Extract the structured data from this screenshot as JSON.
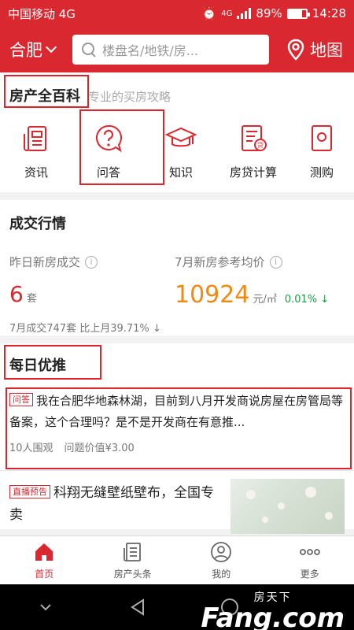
{
  "status_bar": {
    "carrier": "中国移动 4G",
    "network": "4G",
    "battery": "89%",
    "time": "14:28"
  },
  "header": {
    "city": "合肥",
    "search_placeholder": "楼盘名/地铁/房...",
    "map_label": "地图"
  },
  "encyclopedia": {
    "title": "房产全百科",
    "subtitle": "专业的买房攻略",
    "items": [
      {
        "label": "资讯",
        "icon": "news-icon"
      },
      {
        "label": "问答",
        "icon": "question-icon"
      },
      {
        "label": "知识",
        "icon": "graduation-cap-icon"
      },
      {
        "label": "房贷计算",
        "icon": "loan-calculator-icon"
      },
      {
        "label": "测购",
        "icon": "assess-icon"
      }
    ]
  },
  "market": {
    "title": "成交行情",
    "new_sales_label": "昨日新房成交",
    "new_sales_value": "6",
    "new_sales_unit": "套",
    "avg_price_label": "7月新房参考均价",
    "avg_price_value": "10924",
    "avg_price_unit": "元/㎡",
    "avg_price_change": "0.01%",
    "month_summary": "7月成交747套 比上月39.71%"
  },
  "daily": {
    "title": "每日优推",
    "qa_tag": "问答",
    "qa_question": "我在合肥华地森林湖，目前到八月开发商说房屋在房管局等备案，这个合理吗？是不是开发商在有意推...",
    "qa_views": "10人围观",
    "qa_value": "问题价值¥3.00",
    "live_tag": "直播预告",
    "live_title": "科翔无缝壁纸壁布，全国专卖"
  },
  "tabbar": [
    {
      "label": "首页",
      "icon": "home-icon"
    },
    {
      "label": "房产头条",
      "icon": "headline-icon"
    },
    {
      "label": "我的",
      "icon": "profile-icon"
    },
    {
      "label": "更多",
      "icon": "more-icon"
    }
  ],
  "watermark": {
    "cn": "房天下",
    "en": "Fang.com"
  },
  "colors": {
    "brand_red": "#d9282f",
    "price_orange": "#ef8a16",
    "up_green": "#1b9d44",
    "annotation_red": "#e0232b"
  }
}
